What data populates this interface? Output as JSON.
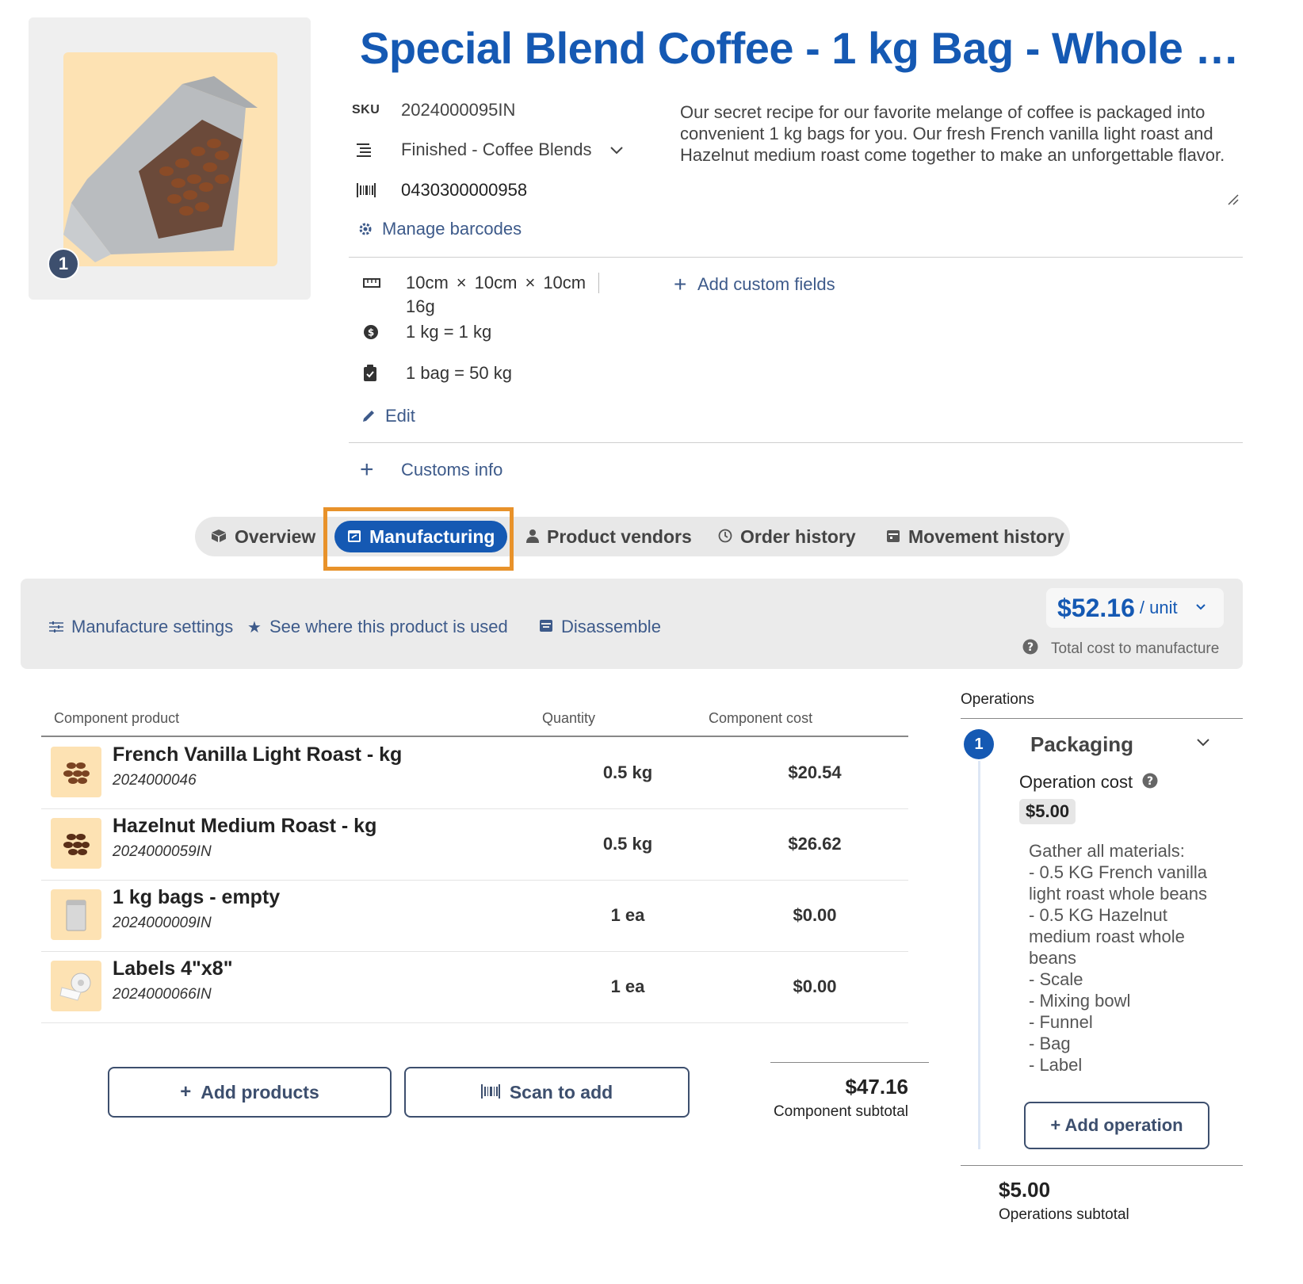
{
  "product": {
    "title": "Special Blend Coffee - 1 kg Bag - Whole B...",
    "image_badge": "1",
    "sku_label": "SKU",
    "sku": "2024000095IN",
    "category": "Finished - Coffee Blends",
    "barcode": "0430300000958",
    "manage_barcodes": "Manage barcodes",
    "description": "Our secret recipe for our favorite melange of coffee is packaged into convenient 1 kg bags for you. Our fresh French vanilla light roast and Hazelnut medium roast come together to make an unforgettable flavor.",
    "dim_l": "10cm",
    "dim_w": "10cm",
    "dim_h": "10cm",
    "dim_sep": "×",
    "weight": "16g",
    "unit_conversion": "1 kg = 1 kg",
    "pack_conversion": "1 bag = 50 kg",
    "add_custom_fields": "Add custom fields",
    "edit": "Edit",
    "customs_info": "Customs info"
  },
  "tabs": [
    {
      "label": "Overview",
      "icon": "box-icon"
    },
    {
      "label": "Manufacturing",
      "icon": "calendar-icon",
      "active": true
    },
    {
      "label": "Product vendors",
      "icon": "person-icon"
    },
    {
      "label": "Order history",
      "icon": "clock-icon"
    },
    {
      "label": "Movement history",
      "icon": "calendar-icon"
    }
  ],
  "toolbar": {
    "manufacture_settings": "Manufacture settings",
    "where_used": "See where this product is used",
    "disassemble": "Disassemble",
    "price": "$52.16",
    "price_unit": "/ unit",
    "total_cost_label": "Total cost to manufacture"
  },
  "components": {
    "headers": [
      "Component product",
      "Quantity",
      "Component cost"
    ],
    "rows": [
      {
        "name": "French Vanilla Light Roast - kg",
        "sku": "2024000046",
        "qty": "0.5 kg",
        "cost": "$20.54"
      },
      {
        "name": "Hazelnut Medium Roast - kg",
        "sku": "2024000059IN",
        "qty": "0.5 kg",
        "cost": "$26.62"
      },
      {
        "name": "1 kg bags - empty",
        "sku": "2024000009IN",
        "qty": "1 ea",
        "cost": "$0.00"
      },
      {
        "name": "Labels 4\"x8\"",
        "sku": "2024000066IN",
        "qty": "1 ea",
        "cost": "$0.00"
      }
    ],
    "add_products": "Add products",
    "scan_to_add": "Scan to add",
    "subtotal": "$47.16",
    "subtotal_label": "Component subtotal"
  },
  "operations": {
    "header": "Operations",
    "items": [
      {
        "number": "1",
        "title": "Packaging",
        "cost_label": "Operation cost",
        "cost": "$5.00",
        "notes": "Gather all materials:\n- 0.5 KG French vanilla light roast whole beans\n- 0.5 KG Hazelnut medium roast whole beans\n- Scale\n- Mixing bowl\n- Funnel\n- Bag\n- Label"
      }
    ],
    "add_operation": "+ Add operation",
    "subtotal": "$5.00",
    "subtotal_label": "Operations subtotal"
  },
  "colors": {
    "accent": "#1559b3",
    "highlight": "#e8922a",
    "link": "#3d5a8a",
    "thumb_bg": "#fde2b3"
  }
}
